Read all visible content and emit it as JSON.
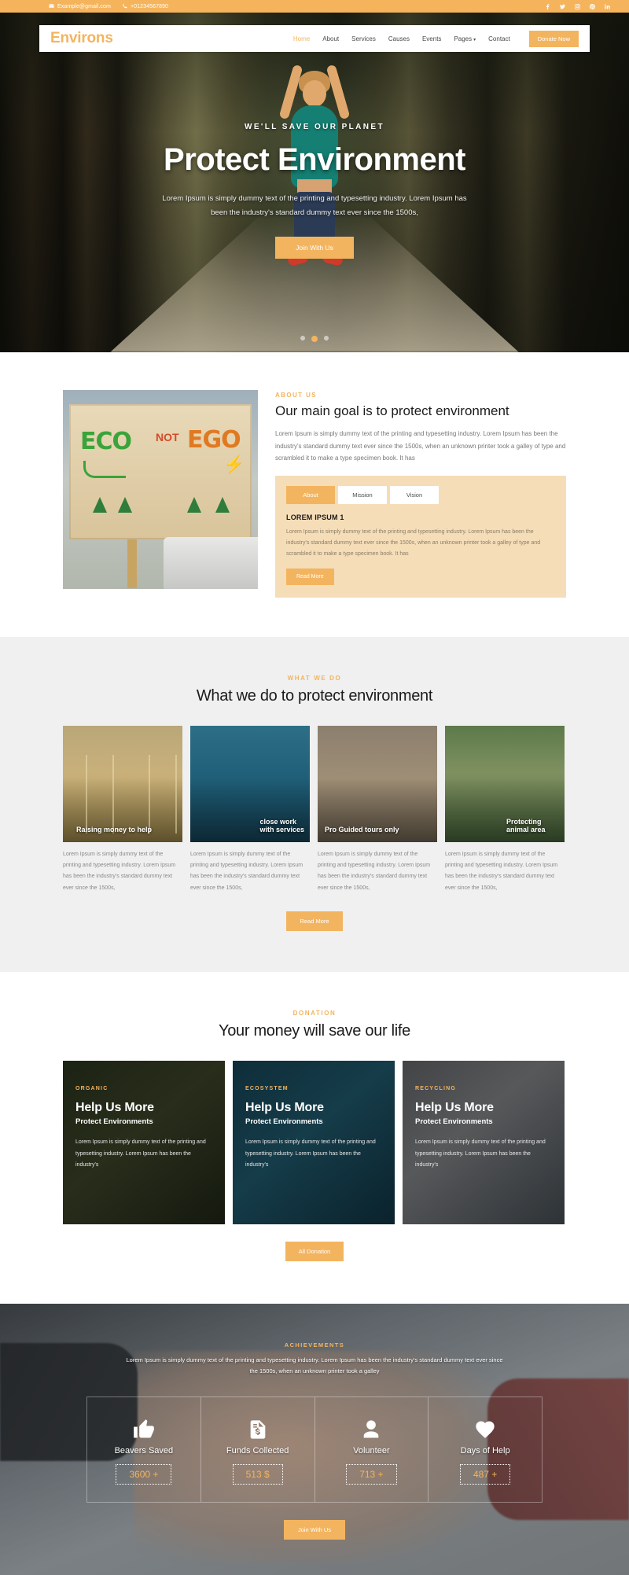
{
  "topbar": {
    "email": "Example@gmail.com",
    "phone": "+01234567890",
    "socials": [
      "facebook-icon",
      "twitter-icon",
      "instagram-icon",
      "pinterest-icon",
      "linkedin-icon"
    ]
  },
  "header": {
    "brand": "Environs",
    "nav": [
      {
        "label": "Home",
        "active": true
      },
      {
        "label": "About",
        "active": false
      },
      {
        "label": "Services",
        "active": false
      },
      {
        "label": "Causes",
        "active": false
      },
      {
        "label": "Events",
        "active": false
      },
      {
        "label": "Pages",
        "active": false,
        "caret": "▾"
      },
      {
        "label": "Contact",
        "active": false
      }
    ],
    "donate_label": "Donate Now"
  },
  "hero": {
    "kicker": "WE'LL SAVE OUR PLANET",
    "title": "Protect Environment",
    "description": "Lorem Ipsum is simply dummy text of the printing and typesetting industry. Lorem Ipsum has been the industry's standard dummy text ever since the 1500s,",
    "cta": "Join With Us",
    "slide_count": 3,
    "active_slide": 2
  },
  "about": {
    "kicker": "ABOUT US",
    "title": "Our main goal is to protect environment",
    "text": "Lorem Ipsum is simply dummy text of the printing and typesetting industry. Lorem Ipsum has been the industry's standard dummy text ever since the 1500s, when an unknown printer took a galley of type and scrambled it to make a type specimen book. It has",
    "image_text": {
      "eco": "ECO",
      "not": "NOT",
      "ego": "EGO"
    },
    "tabs": [
      {
        "label": "About",
        "active": true
      },
      {
        "label": "Mission",
        "active": false
      },
      {
        "label": "Vision",
        "active": false
      }
    ],
    "panel_heading": "LOREM IPSUM 1",
    "panel_text": "Lorem Ipsum is simply dummy text of the printing and typesetting industry. Lorem Ipsum has been the industry's standard dummy text ever since the 1500s, when an unknown printer took a galley of type and scrambled it to make a type specimen book. It has",
    "read_more": "Read More"
  },
  "whatwedo": {
    "kicker": "WHAT WE DO",
    "title": "What we do to protect environment",
    "cards": [
      {
        "title": "Raising money to help",
        "text": "Lorem Ipsum is simply dummy text of the printing and typesetting industry. Lorem Ipsum has been the industry's standard dummy text ever since the 1500s,"
      },
      {
        "title": "close work with services",
        "text": "Lorem Ipsum is simply dummy text of the printing and typesetting industry. Lorem Ipsum has been the industry's standard dummy text ever since the 1500s,"
      },
      {
        "title": "Pro Guided tours only",
        "text": "Lorem Ipsum is simply dummy text of the printing and typesetting industry. Lorem Ipsum has been the industry's standard dummy text ever since the 1500s,"
      },
      {
        "title": "Protecting animal area",
        "text": "Lorem Ipsum is simply dummy text of the printing and typesetting industry. Lorem Ipsum has been the industry's standard dummy text ever since the 1500s,"
      }
    ],
    "read_more": "Read More"
  },
  "donation": {
    "kicker": "DONATION",
    "title": "Your money will save our life",
    "cards": [
      {
        "category": "ORGANIC",
        "heading": "Help Us More",
        "subheading": "Protect Environments",
        "text": "Lorem Ipsum is simply dummy text of the printing and typesetting industry. Lorem Ipsum has been the industry's"
      },
      {
        "category": "ECOSYSTEM",
        "heading": "Help Us More",
        "subheading": "Protect Environments",
        "text": "Lorem Ipsum is simply dummy text of the printing and typesetting industry. Lorem Ipsum has been the industry's"
      },
      {
        "category": "RECYCLING",
        "heading": "Help Us More",
        "subheading": "Protect Environments",
        "text": "Lorem Ipsum is simply dummy text of the printing and typesetting industry. Lorem Ipsum has been the industry's"
      }
    ],
    "all_donation": "All Donation"
  },
  "achievements": {
    "kicker": "ACHIEVEMENTS",
    "description": "Lorem Ipsum is simply dummy text of the printing and typesetting industry. Lorem Ipsum has been the industry's standard dummy text ever since the 1500s, when an unknown printer took a galley",
    "stats": [
      {
        "icon": "thumbs-up-icon",
        "label": "Beavers Saved",
        "value": "3600 +"
      },
      {
        "icon": "invoice-dollar-icon",
        "label": "Funds Collected",
        "value": "513 $"
      },
      {
        "icon": "user-icon",
        "label": "Volunteer",
        "value": "713 +"
      },
      {
        "icon": "heart-icon",
        "label": "Days of Help",
        "value": "487 +"
      }
    ],
    "cta": "Join With Us"
  },
  "colors": {
    "accent": "#f3b45f",
    "topbar": "#f5b45c",
    "light_section": "#f0f0f0",
    "tab_panel": "#f5ddb8"
  }
}
